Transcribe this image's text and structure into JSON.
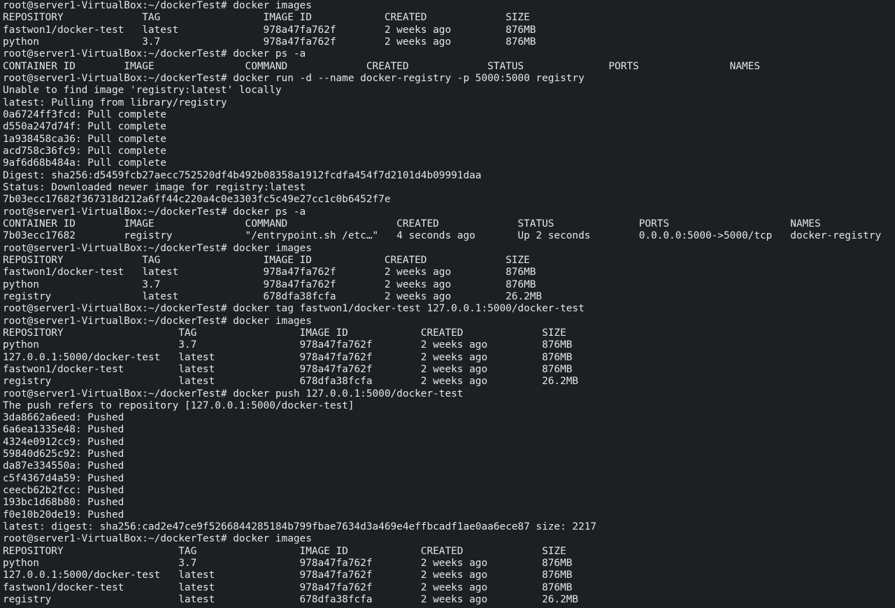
{
  "terminal": {
    "colors": {
      "background": "#1c2023",
      "text": "#e6e6e6"
    },
    "lines": [
      "root@server1-VirtualBox:~/dockerTest# docker images",
      "REPOSITORY             TAG                 IMAGE ID            CREATED             SIZE",
      "fastwon1/docker-test   latest              978a47fa762f        2 weeks ago         876MB",
      "python                 3.7                 978a47fa762f        2 weeks ago         876MB",
      "root@server1-VirtualBox:~/dockerTest# docker ps -a",
      "CONTAINER ID        IMAGE               COMMAND             CREATED             STATUS              PORTS               NAMES",
      "root@server1-VirtualBox:~/dockerTest# docker run -d --name docker-registry -p 5000:5000 registry",
      "Unable to find image 'registry:latest' locally",
      "latest: Pulling from library/registry",
      "0a6724ff3fcd: Pull complete",
      "d550a247d74f: Pull complete",
      "1a938458ca36: Pull complete",
      "acd758c36fc9: Pull complete",
      "9af6d68b484a: Pull complete",
      "Digest: sha256:d5459fcb27aecc752520df4b492b08358a1912fcdfa454f7d2101d4b09991daa",
      "Status: Downloaded newer image for registry:latest",
      "7b03ecc17682f367318d212a6ff44c220a4c0e3303fc5c49e27cc1c0b6452f7e",
      "root@server1-VirtualBox:~/dockerTest# docker ps -a",
      "CONTAINER ID        IMAGE               COMMAND                  CREATED             STATUS              PORTS                    NAMES",
      "7b03ecc17682        registry            \"/entrypoint.sh /etc…\"   4 seconds ago       Up 2 seconds        0.0.0.0:5000->5000/tcp   docker-registry",
      "root@server1-VirtualBox:~/dockerTest# docker images",
      "REPOSITORY             TAG                 IMAGE ID            CREATED             SIZE",
      "fastwon1/docker-test   latest              978a47fa762f        2 weeks ago         876MB",
      "python                 3.7                 978a47fa762f        2 weeks ago         876MB",
      "registry               latest              678dfa38fcfa        2 weeks ago         26.2MB",
      "root@server1-VirtualBox:~/dockerTest# docker tag fastwon1/docker-test 127.0.0.1:5000/docker-test",
      "root@server1-VirtualBox:~/dockerTest# docker images",
      "REPOSITORY                   TAG                 IMAGE ID            CREATED             SIZE",
      "python                       3.7                 978a47fa762f        2 weeks ago         876MB",
      "127.0.0.1:5000/docker-test   latest              978a47fa762f        2 weeks ago         876MB",
      "fastwon1/docker-test         latest              978a47fa762f        2 weeks ago         876MB",
      "registry                     latest              678dfa38fcfa        2 weeks ago         26.2MB",
      "root@server1-VirtualBox:~/dockerTest# docker push 127.0.0.1:5000/docker-test",
      "The push refers to repository [127.0.0.1:5000/docker-test]",
      "3da8662a6eed: Pushed",
      "6a6ea1335e48: Pushed",
      "4324e0912cc9: Pushed",
      "59840d625c92: Pushed",
      "da87e334550a: Pushed",
      "c5f4367d4a59: Pushed",
      "ceecb62b2fcc: Pushed",
      "193bc1d68b80: Pushed",
      "f0e10b20de19: Pushed",
      "latest: digest: sha256:cad2e47ce9f5266844285184b799fbae7634d3a469e4effbcadf1ae0aa6ece87 size: 2217",
      "root@server1-VirtualBox:~/dockerTest# docker images",
      "REPOSITORY                   TAG                 IMAGE ID            CREATED             SIZE",
      "python                       3.7                 978a47fa762f        2 weeks ago         876MB",
      "127.0.0.1:5000/docker-test   latest              978a47fa762f        2 weeks ago         876MB",
      "fastwon1/docker-test         latest              978a47fa762f        2 weeks ago         876MB",
      "registry                     latest              678dfa38fcfa        2 weeks ago         26.2MB"
    ]
  }
}
